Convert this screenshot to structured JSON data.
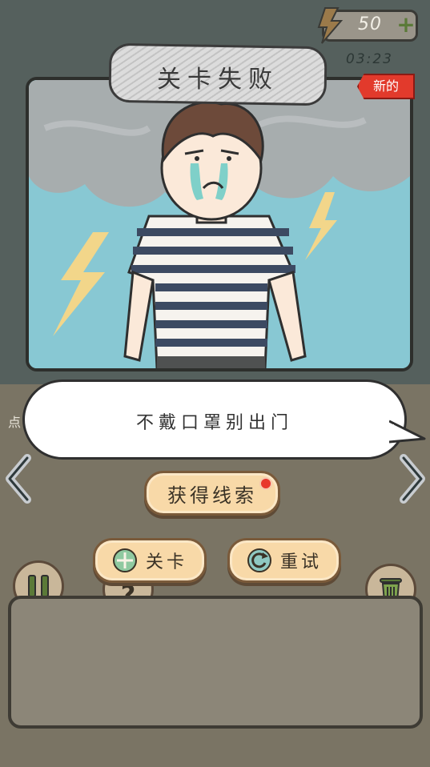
{
  "title": "关卡失败",
  "coins": {
    "value": "50",
    "plus_label": "+",
    "icon": "lightning-bolt-icon"
  },
  "timer": "03:23",
  "new_badge": "新的",
  "dialogue": "不戴口罩别出门",
  "left_hint": "点",
  "buttons": {
    "clue": "获得线索",
    "levels": "关卡",
    "retry": "重试"
  },
  "tool_buttons": {
    "pause": "pause-icon",
    "hint": "?",
    "trash": "trash-icon"
  },
  "colors": {
    "button_fill": "#f8d9a8",
    "badge_red": "#e23a2c",
    "sky": "#88c8d3",
    "bolt_yellow": "#f2d68a"
  }
}
